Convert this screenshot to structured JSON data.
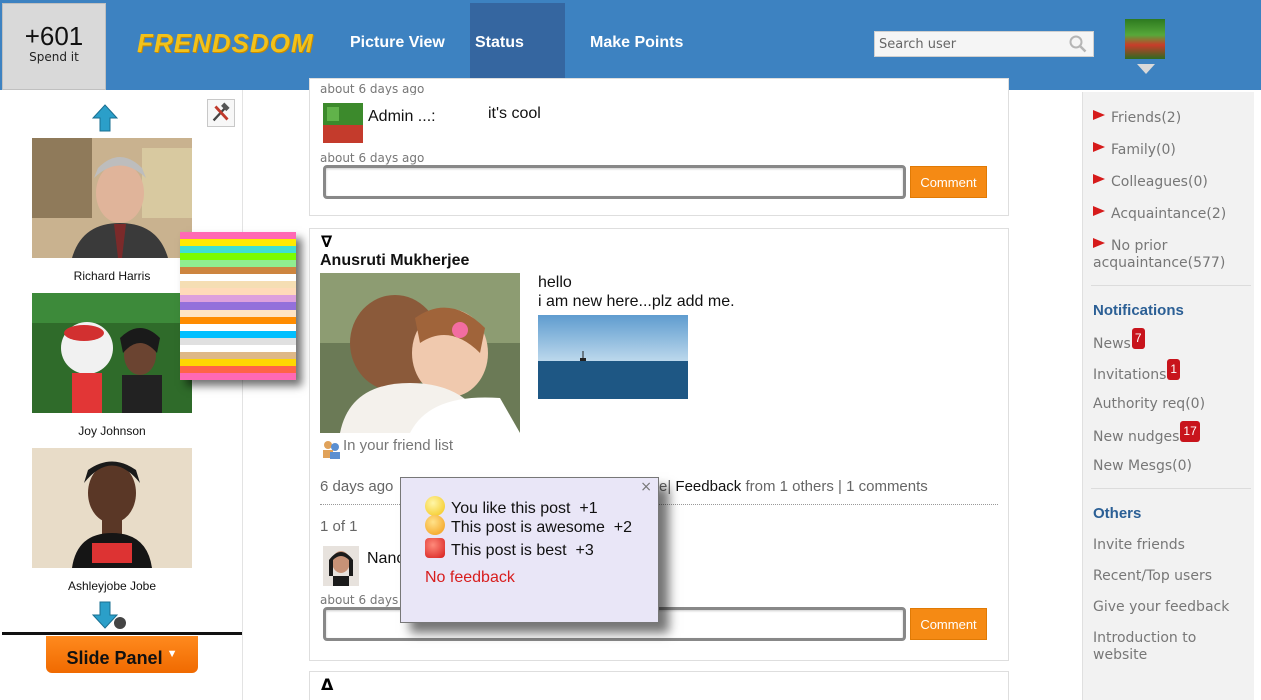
{
  "header": {
    "points_value": "+601",
    "points_label": "Spend it",
    "logo_text": "FRENDSDOM",
    "nav": [
      {
        "label": "Picture View",
        "active": false
      },
      {
        "label": "Status View",
        "active": true
      },
      {
        "label": "Make Points",
        "active": false
      }
    ],
    "search_placeholder": "Search user"
  },
  "left_panel": {
    "friends": [
      {
        "name": "Richard Harris"
      },
      {
        "name": "Joy Johnson"
      },
      {
        "name": "Ashleyjobe Jobe"
      }
    ],
    "palette_colors": [
      "#ff69b4",
      "#ffea00",
      "#40e0d0",
      "#7cfc00",
      "#90ee90",
      "#cd853f",
      "#ffffff",
      "#f5deb3",
      "#ffdab9",
      "#dda0dd",
      "#9370db",
      "#ffe4c4",
      "#ff8c00",
      "#ffffff",
      "#00bfff",
      "#e0e0e0",
      "#ffffff",
      "#deb887",
      "#ffd700",
      "#ff6347",
      "#ff69b4"
    ],
    "slide_panel_label": "Slide Panel",
    "slide_panel_caret": "▼"
  },
  "feed": {
    "post1": {
      "partial_time_top": "about 6 days ago",
      "comment_author": "Admin ...:",
      "comment_text": "it's cool",
      "comment_time": "about 6 days ago",
      "comment_button": "Comment"
    },
    "post2": {
      "collapse_marker": "∇",
      "author": "Anusruti Mukherjee",
      "text_line1": "hello",
      "text_line2": "i am new here...plz add me.",
      "friend_status": "In your friend list",
      "time": "6 days ago",
      "feedback_hidden_tail": "e|",
      "feedback_link": "Feedback",
      "feedback_from": "from 1 others",
      "separator": "|",
      "comments_count": "1 comments",
      "pager": "1 of 1",
      "commenter_partial": "Nanc",
      "comment_time_partial": "about 6 days a",
      "comment_button": "Comment"
    },
    "post3": {
      "collapse_marker": "Δ"
    }
  },
  "feedback_popup": {
    "close": "×",
    "options": [
      {
        "label": "You like this post",
        "points": "+1"
      },
      {
        "label": "This post is awesome",
        "points": "+2"
      },
      {
        "label": "This post is best",
        "points": "+3"
      }
    ],
    "no_feedback": "No feedback"
  },
  "right_panel": {
    "groups": [
      {
        "label": "Friends(2)"
      },
      {
        "label": "Family(0)"
      },
      {
        "label": "Colleagues(0)"
      },
      {
        "label": "Acquaintance(2)"
      },
      {
        "label": "No prior acquaintance(577)"
      }
    ],
    "notifications_heading": "Notifications",
    "notifications": [
      {
        "label": "News",
        "badge": "7"
      },
      {
        "label": "Invitations",
        "badge": "1"
      },
      {
        "label": "Authority req(0)",
        "badge": ""
      },
      {
        "label": "New nudges",
        "badge": "17"
      },
      {
        "label": "New Mesgs(0)",
        "badge": ""
      }
    ],
    "others_heading": "Others",
    "others": [
      {
        "label": "Invite friends"
      },
      {
        "label": "Recent/Top users"
      },
      {
        "label": "Give your feedback"
      },
      {
        "label": "Introduction to website"
      }
    ]
  }
}
